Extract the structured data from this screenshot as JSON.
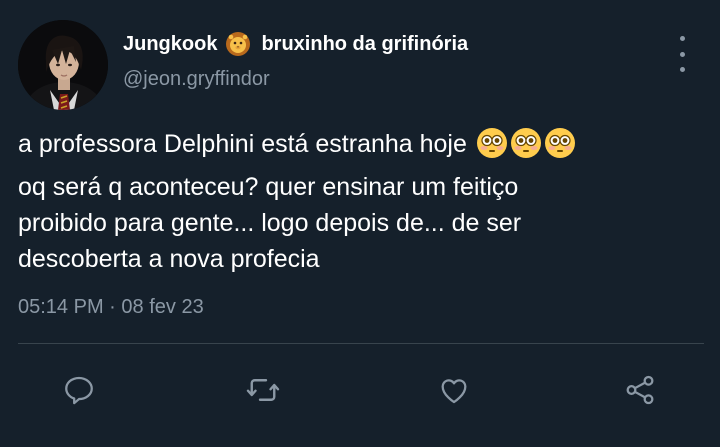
{
  "user": {
    "display_name": "Jungkook",
    "badge_icon": "lion-face-emoji-icon",
    "display_name_suffix": "bruxinho da grifinória",
    "handle": "@jeon.gryffindor"
  },
  "tweet": {
    "lines": [
      "a professora Delphini está estranha hoje",
      "oq será q aconteceu? quer ensinar um feitiço",
      "proibido para gente... logo depois de... de ser",
      "descoberta a nova profecia"
    ],
    "emoji": [
      "flushed-face-emoji-icon",
      "flushed-face-emoji-icon",
      "flushed-face-emoji-icon"
    ]
  },
  "meta": {
    "time": "05:14 PM",
    "separator": "·",
    "date": "08 fev 23"
  },
  "actions": [
    {
      "name": "reply",
      "icon": "reply-icon"
    },
    {
      "name": "retweet",
      "icon": "retweet-icon"
    },
    {
      "name": "like",
      "icon": "heart-icon"
    },
    {
      "name": "share",
      "icon": "share-icon"
    }
  ],
  "colors": {
    "background": "#15202b",
    "text": "#ffffff",
    "secondary": "#8b98a5",
    "divider": "#38444d"
  }
}
